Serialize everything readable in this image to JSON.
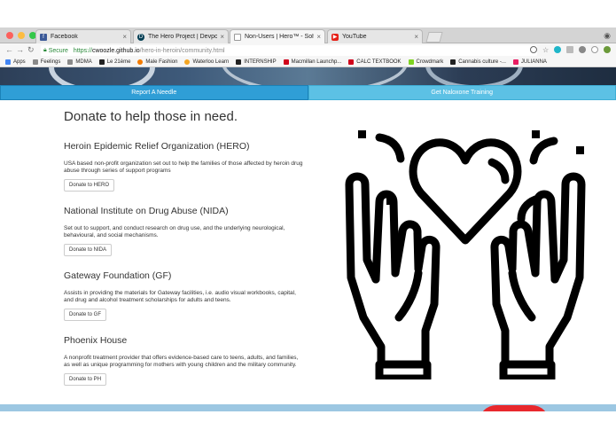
{
  "browser": {
    "tabs": [
      {
        "label": "Facebook",
        "favicon": "facebook-icon",
        "color": "#3b5998"
      },
      {
        "label": "The Hero Project | Devpost",
        "favicon": "devpost-icon",
        "color": "#003e54"
      },
      {
        "label": "Non-Users | Hero™ - Solving",
        "favicon": "page-icon",
        "color": "#999999"
      },
      {
        "label": "YouTube",
        "favicon": "youtube-icon",
        "color": "#e62117"
      }
    ],
    "close_glyph": "×",
    "secure_label": "Secure",
    "url_scheme": "https://",
    "url_host": "cwoozle.github.io",
    "url_path": "/hero-in-heroin/community.html",
    "bookmarks": [
      {
        "label": "Apps",
        "color": "#4285f4"
      },
      {
        "label": "Feelings",
        "color": "#8a8a8a"
      },
      {
        "label": "MDMA",
        "color": "#8a8a8a"
      },
      {
        "label": "Le 21ème",
        "color": "#222222"
      },
      {
        "label": "Male Fashion",
        "color": "#f57c00"
      },
      {
        "label": "Waterloo Learn",
        "color": "#f5a623"
      },
      {
        "label": "INTERNSHIP",
        "color": "#222222"
      },
      {
        "label": "Macmillan Launchp...",
        "color": "#d0021b"
      },
      {
        "label": "CALC TEXTBOOK",
        "color": "#d0021b"
      },
      {
        "label": "Crowdmark",
        "color": "#7ed321"
      },
      {
        "label": "Cannabis culture -...",
        "color": "#222222"
      },
      {
        "label": "JULIANNA",
        "color": "#e91e63"
      }
    ]
  },
  "actions": {
    "report_label": "Report A Needle",
    "naloxone_label": "Get Naloxone Training"
  },
  "page": {
    "title": "Donate to help those in need.",
    "orgs": [
      {
        "name": "Heroin Epidemic Relief Organization (HERO)",
        "desc": "USA based non-profit organization set out to help the families of those affected by heroin drug abuse through series of support programs",
        "button": "Donate to HERO"
      },
      {
        "name": "National Institute on Drug Abuse (NIDA)",
        "desc": "Set out to support, and conduct research on drug use, and the underlying neurological, behavioural, and social mechanisms.",
        "button": "Donate to NIDA"
      },
      {
        "name": "Gateway Foundation (GF)",
        "desc": "Assists in providing the materials for Gateway facilities, i.e. audio visual workbooks, capital, and drug and alcohol treatment scholarships for adults and teens.",
        "button": "Donate to GF"
      },
      {
        "name": "Phoenix House",
        "desc": "A nonprofit treatment provider that offers evidence-based care to teens, adults, and families, as well as unique programming for mothers with young children and the military community.",
        "button": "Donate to PH"
      }
    ]
  },
  "colors": {
    "report_button": "#2f9ed6",
    "naloxone_button": "#5cc1e5",
    "footer": "#9cc7e2"
  }
}
